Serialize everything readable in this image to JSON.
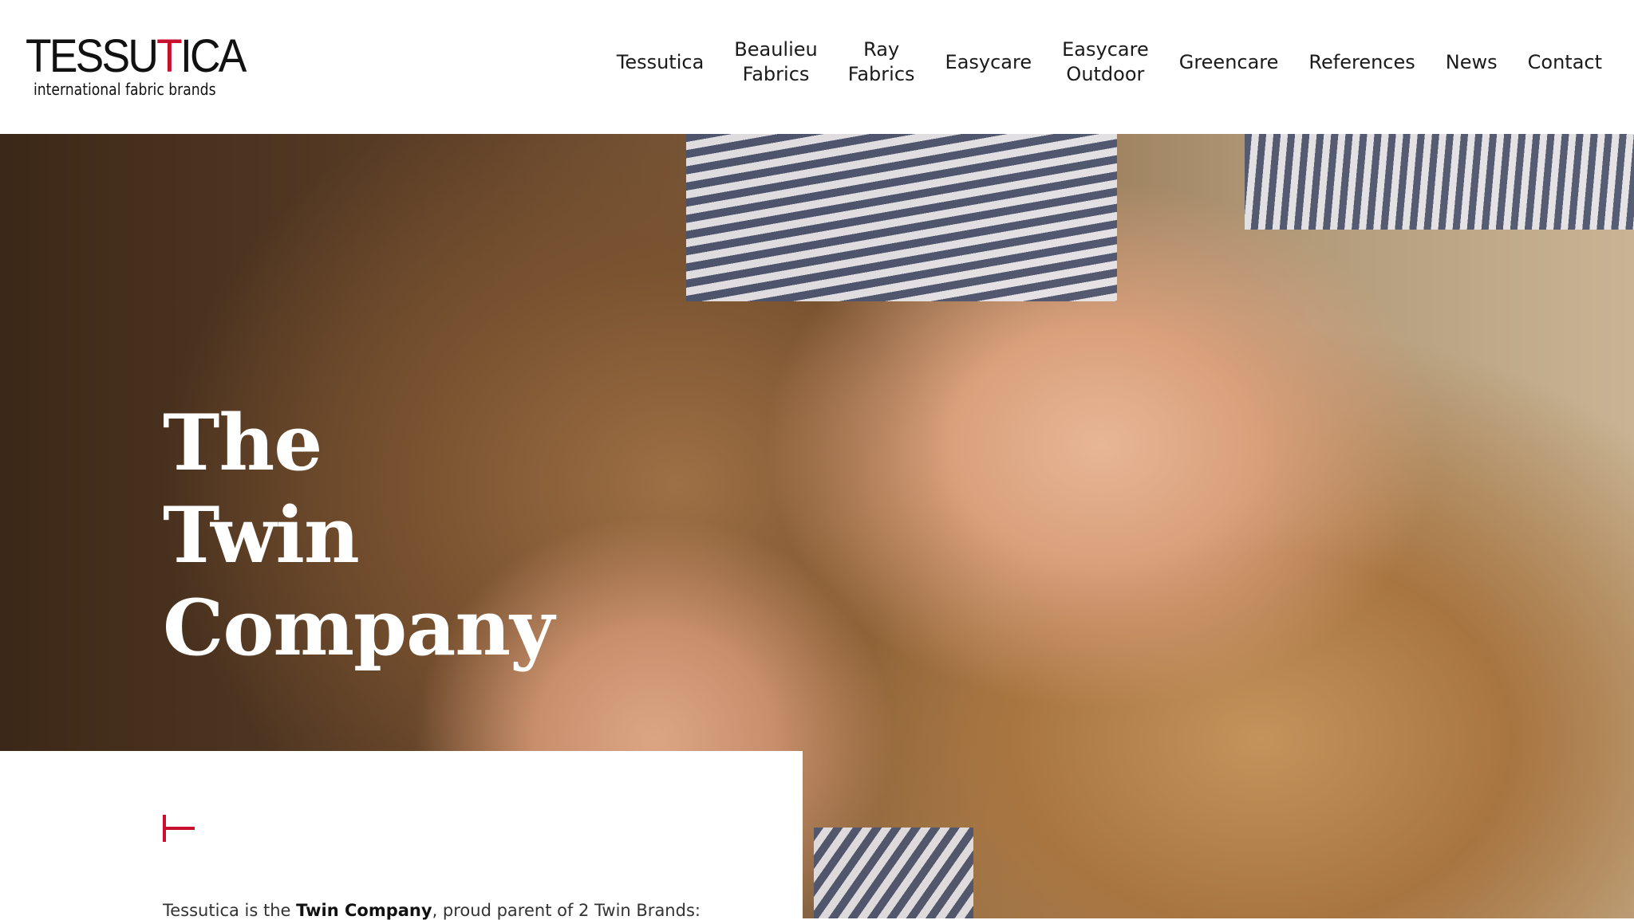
{
  "brand": {
    "name_before": "TESSU",
    "name_accent": "T",
    "name_after": "ICA",
    "tagline": "international fabric brands",
    "accent_color": "#c8102e"
  },
  "nav": {
    "items": [
      {
        "label": "Tessutica"
      },
      {
        "label": "Beaulieu\nFabrics"
      },
      {
        "label": "Ray\nFabrics"
      },
      {
        "label": "Easycare"
      },
      {
        "label": "Easycare\nOutdoor"
      },
      {
        "label": "Greencare"
      },
      {
        "label": "References"
      },
      {
        "label": "News"
      },
      {
        "label": "Contact"
      }
    ]
  },
  "hero": {
    "title": "The\nTwin\nCompany",
    "image_description": ""
  },
  "content": {
    "icon": "tessutica-mark-icon",
    "intro_before": "Tessutica is the ",
    "intro_bold": "Twin Company",
    "intro_after": ", proud parent of 2 Twin Brands:"
  }
}
